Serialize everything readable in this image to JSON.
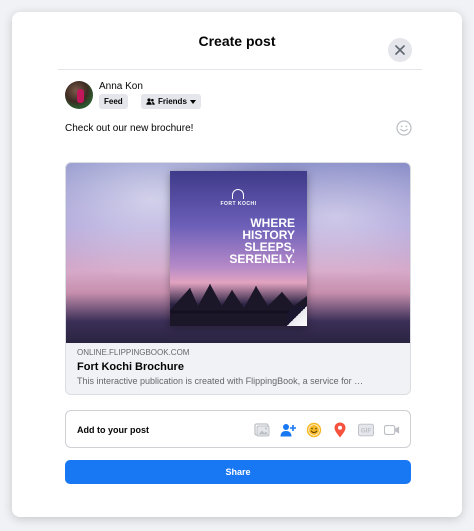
{
  "dialog": {
    "title": "Create post"
  },
  "user": {
    "name": "Anna Kon",
    "feed_label": "Feed",
    "audience_label": "Friends"
  },
  "post": {
    "text": "Check out our new brochure!"
  },
  "link_preview": {
    "domain": "ONLINE.FLIPPINGBOOK.COM",
    "title": "Fort Kochi Brochure",
    "description": "This interactive publication is created with FlippingBook, a service for …",
    "image": {
      "brand_text": "FORT KOCHI",
      "headline": "WHERE\nHISTORY\nSLEEPS,\nSERENELY."
    }
  },
  "add_to_post": {
    "label": "Add to your post",
    "icons": [
      "photo-icon",
      "tag-people-icon",
      "feeling-icon",
      "location-icon",
      "gif-icon",
      "live-video-icon"
    ]
  },
  "share_button": {
    "label": "Share"
  },
  "colors": {
    "accent": "#1877f2",
    "tag_people": "#1877f2",
    "feeling": "#f7b928",
    "location": "#f5533d",
    "disabled": "#bcc0c4"
  }
}
